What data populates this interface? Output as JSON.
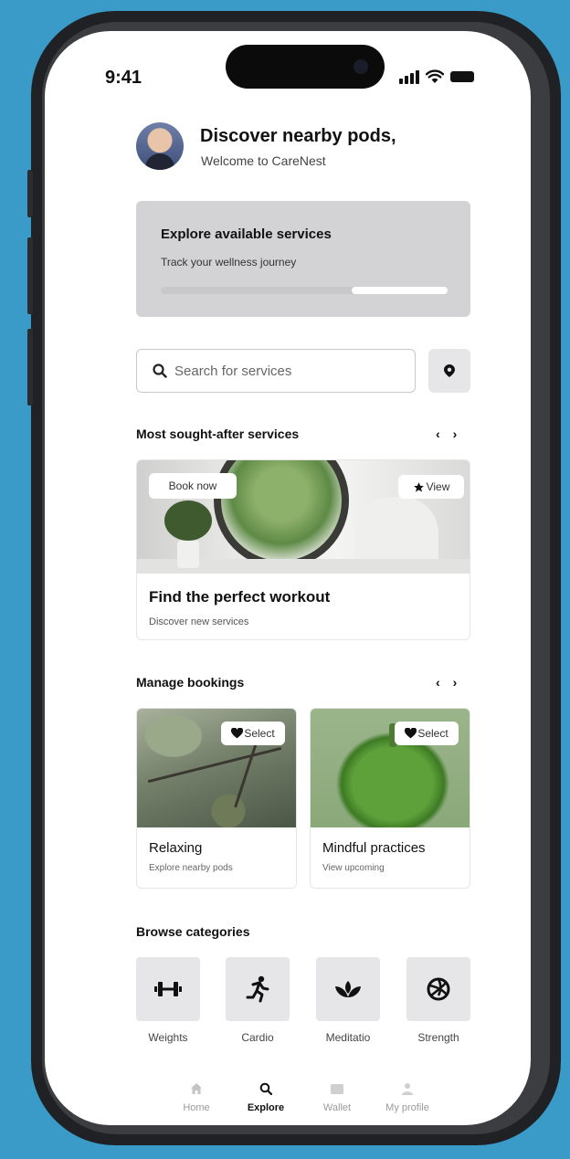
{
  "status": {
    "time": "9:41"
  },
  "header": {
    "title": "Discover nearby pods,",
    "subtitle": "Welcome to CareNest"
  },
  "hero": {
    "title": "Explore available services",
    "subtitle": "Track your wellness journey",
    "progress": 0.33
  },
  "search": {
    "placeholder": "Search for services"
  },
  "popular": {
    "title": "Most sought-after services",
    "book_label": "Book now",
    "view_label": "View",
    "card_title": "Find the perfect workout",
    "card_subtitle": "Discover new services"
  },
  "bookings": {
    "title": "Manage bookings",
    "cards": [
      {
        "select_label": "Select",
        "title": "Relaxing",
        "subtitle": "Explore nearby pods"
      },
      {
        "select_label": "Select",
        "title": "Mindful practices",
        "subtitle": "View upcoming"
      }
    ]
  },
  "categories": {
    "title": "Browse categories",
    "items": [
      {
        "label": "Weights",
        "icon": "dumbbell-icon"
      },
      {
        "label": "Cardio",
        "icon": "running-icon"
      },
      {
        "label": "Meditatio",
        "icon": "lotus-icon"
      },
      {
        "label": "Strength",
        "icon": "volleyball-icon"
      }
    ]
  },
  "nav": {
    "items": [
      {
        "label": "Home",
        "icon": "home-icon",
        "active": false
      },
      {
        "label": "Explore",
        "icon": "search-icon",
        "active": true
      },
      {
        "label": "Wallet",
        "icon": "wallet-icon",
        "active": false
      },
      {
        "label": "My profile",
        "icon": "user-icon",
        "active": false
      }
    ]
  },
  "colors": {
    "background": "#3a9bc8",
    "tile": "#e6e6e8",
    "hero": "#d3d3d5"
  }
}
